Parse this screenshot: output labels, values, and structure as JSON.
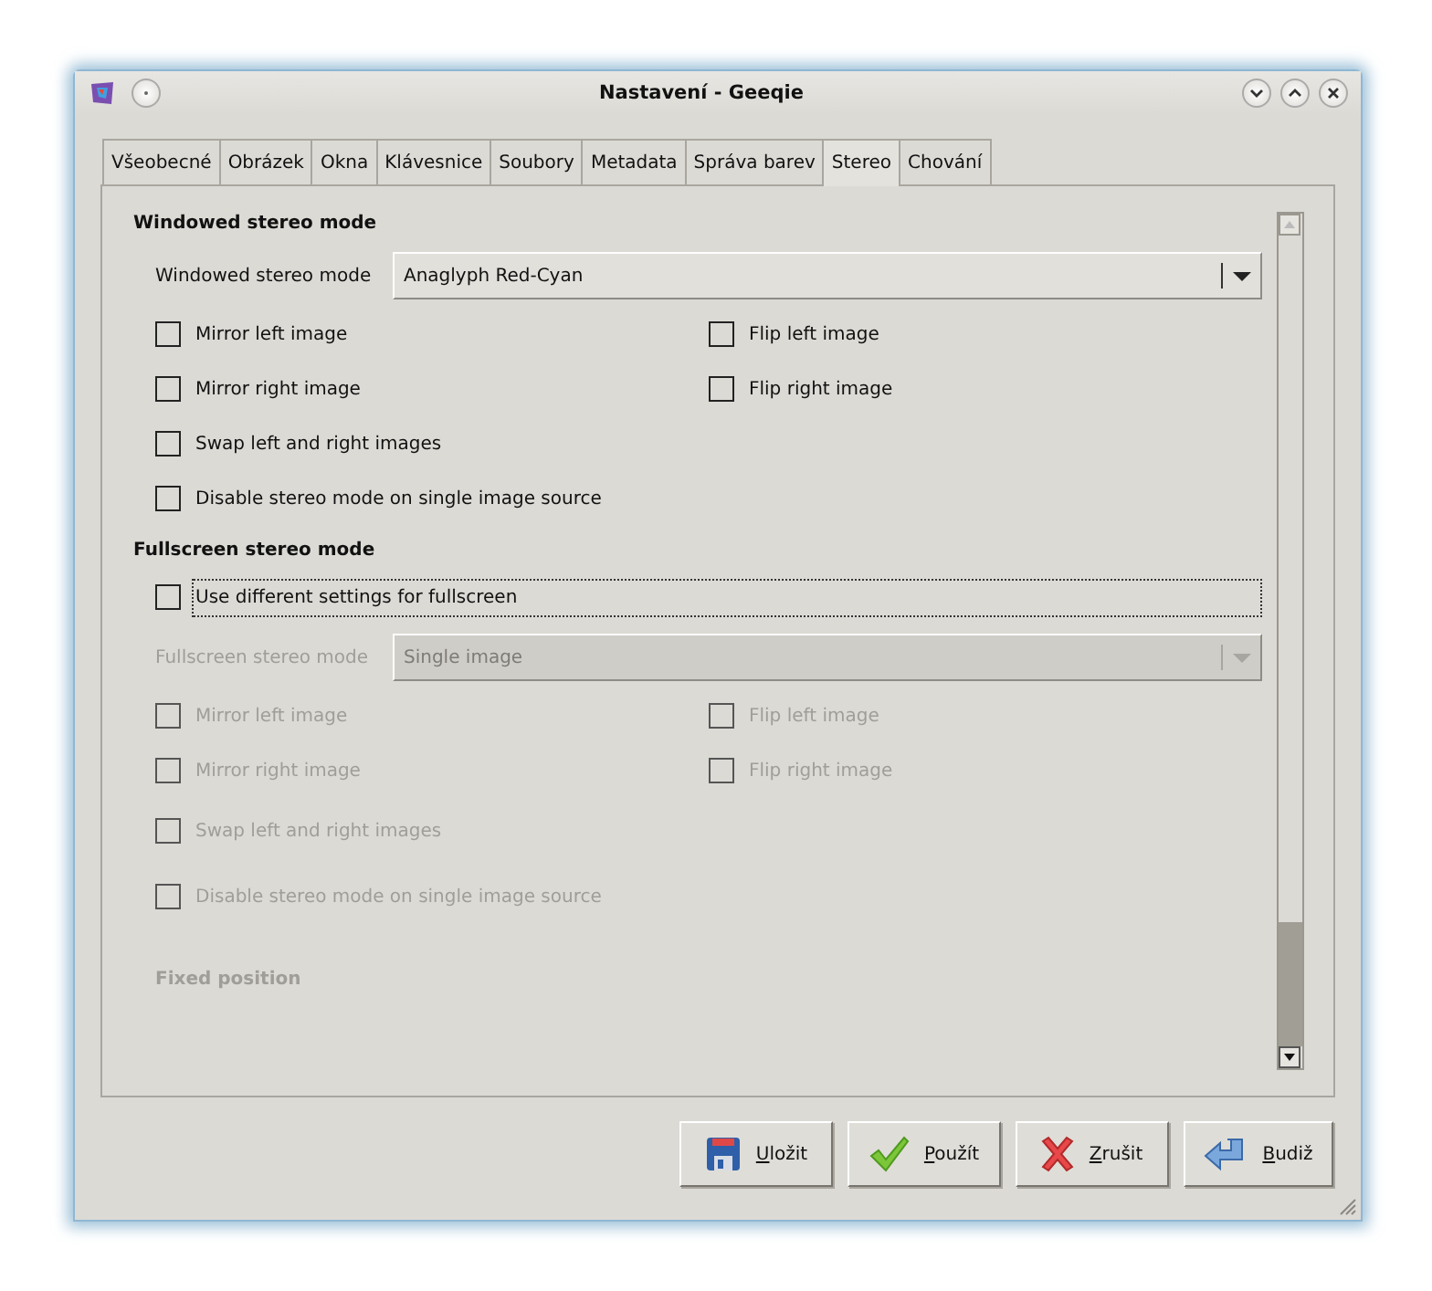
{
  "window": {
    "title": "Nastavení - Geeqie"
  },
  "tabs": [
    {
      "label": "Všeobecné",
      "selected": false
    },
    {
      "label": "Obrázek",
      "selected": false
    },
    {
      "label": "Okna",
      "selected": false
    },
    {
      "label": "Klávesnice",
      "selected": false
    },
    {
      "label": "Soubory",
      "selected": false
    },
    {
      "label": "Metadata",
      "selected": false
    },
    {
      "label": "Správa barev",
      "selected": false
    },
    {
      "label": "Stereo",
      "selected": true
    },
    {
      "label": "Chování",
      "selected": false
    }
  ],
  "windowed": {
    "heading": "Windowed stereo mode",
    "mode_label": "Windowed stereo mode",
    "mode_value": "Anaglyph Red-Cyan",
    "rows": [
      [
        {
          "label": "Mirror left image",
          "checked": false
        },
        {
          "label": "Flip left image",
          "checked": false
        }
      ],
      [
        {
          "label": "Mirror right image",
          "checked": false
        },
        {
          "label": "Flip right image",
          "checked": false
        }
      ],
      [
        {
          "label": "Swap left and right images",
          "checked": false
        }
      ],
      [
        {
          "label": "Disable stereo mode on single image source",
          "checked": false
        }
      ]
    ]
  },
  "fullscreen": {
    "heading": "Fullscreen stereo mode",
    "toggle": {
      "label": "Use different settings for fullscreen",
      "checked": false
    },
    "disabled": true,
    "mode_label": "Fullscreen stereo mode",
    "mode_value": "Single image",
    "rows": [
      [
        {
          "label": "Mirror left image",
          "checked": false
        },
        {
          "label": "Flip left image",
          "checked": false
        }
      ],
      [
        {
          "label": "Mirror right image",
          "checked": false
        },
        {
          "label": "Flip right image",
          "checked": false
        }
      ],
      [
        {
          "label": "Swap left and right images",
          "checked": false
        }
      ],
      [
        {
          "label": "Disable stereo mode on single image source",
          "checked": false
        }
      ]
    ],
    "subheading": "Fixed position"
  },
  "buttons": [
    {
      "label": "Uložit",
      "kind": "save"
    },
    {
      "label": "Použít",
      "kind": "apply"
    },
    {
      "label": "Zrušit",
      "kind": "cancel"
    },
    {
      "label": "Budiž",
      "kind": "ok"
    }
  ]
}
